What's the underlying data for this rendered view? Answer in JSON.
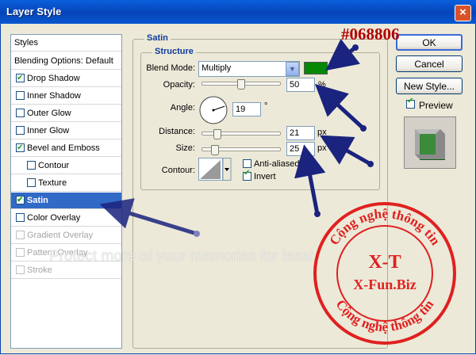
{
  "dialog": {
    "title": "Layer Style"
  },
  "styles_list": {
    "header": "Styles",
    "items": [
      {
        "label": "Blending Options: Default"
      },
      {
        "label": "Drop Shadow",
        "checked": true
      },
      {
        "label": "Inner Shadow",
        "checked": false
      },
      {
        "label": "Outer Glow",
        "checked": false
      },
      {
        "label": "Inner Glow",
        "checked": false
      },
      {
        "label": "Bevel and Emboss",
        "checked": true
      },
      {
        "label": "Contour",
        "checked": false
      },
      {
        "label": "Texture",
        "checked": false
      },
      {
        "label": "Satin",
        "checked": true,
        "selected": true
      },
      {
        "label": "Color Overlay",
        "checked": false
      },
      {
        "label": "Gradient Overlay",
        "checked": false,
        "disabled": true
      },
      {
        "label": "Pattern Overlay",
        "checked": false,
        "disabled": true
      },
      {
        "label": "Stroke",
        "checked": false,
        "disabled": true
      }
    ]
  },
  "satin": {
    "group_title": "Satin",
    "structure_title": "Structure",
    "blend_mode_label": "Blend Mode:",
    "blend_mode_value": "Multiply",
    "blend_color": "#068806",
    "color_annotation": "#068806",
    "opacity_label": "Opacity:",
    "opacity_value": "50",
    "opacity_fraction": 0.5,
    "percent_unit": "%",
    "angle_label": "Angle:",
    "angle_value": "19",
    "degree_unit": "°",
    "distance_label": "Distance:",
    "distance_value": "21",
    "distance_unit": "px",
    "size_label": "Size:",
    "size_value": "25",
    "size_unit": "px",
    "contour_label": "Contour:",
    "anti_aliased_label": "Anti-aliased",
    "anti_aliased_checked": false,
    "invert_label": "Invert",
    "invert_checked": true
  },
  "buttons": {
    "ok": "OK",
    "cancel": "Cancel",
    "new_style": "New Style...",
    "preview_label": "Preview",
    "preview_checked": true
  },
  "watermark": {
    "text": "Protect more of your memories for less!",
    "stamp_top": "Cộng nghệ thông tin",
    "stamp_mid1": "X-T",
    "stamp_mid2": "X-Fun.Biz",
    "stamp_bottom": "Cộng nghệ thông tin"
  },
  "colors": {
    "accent": "#068806",
    "selection": "#3169c6",
    "arrow": "#1a237e",
    "stamp": "#e02020"
  }
}
